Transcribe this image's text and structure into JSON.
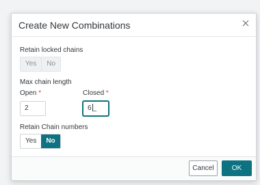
{
  "dialog": {
    "title": "Create New Combinations",
    "close_icon": "close-icon"
  },
  "retain_locked": {
    "label": "Retain locked chains",
    "options": [
      "Yes",
      "No"
    ],
    "state": "disabled"
  },
  "max_chain": {
    "label": "Max chain length",
    "open": {
      "label": "Open",
      "required_mark": "*",
      "value": "2"
    },
    "closed": {
      "label": "Closed",
      "required_mark": "*",
      "value": "6"
    }
  },
  "retain_numbers": {
    "label": "Retain Chain numbers",
    "options": [
      "Yes",
      "No"
    ],
    "selected": "No"
  },
  "footer": {
    "cancel_label": "Cancel",
    "ok_label": "OK"
  },
  "colors": {
    "accent": "#0d7282",
    "required": "#d6453d"
  }
}
